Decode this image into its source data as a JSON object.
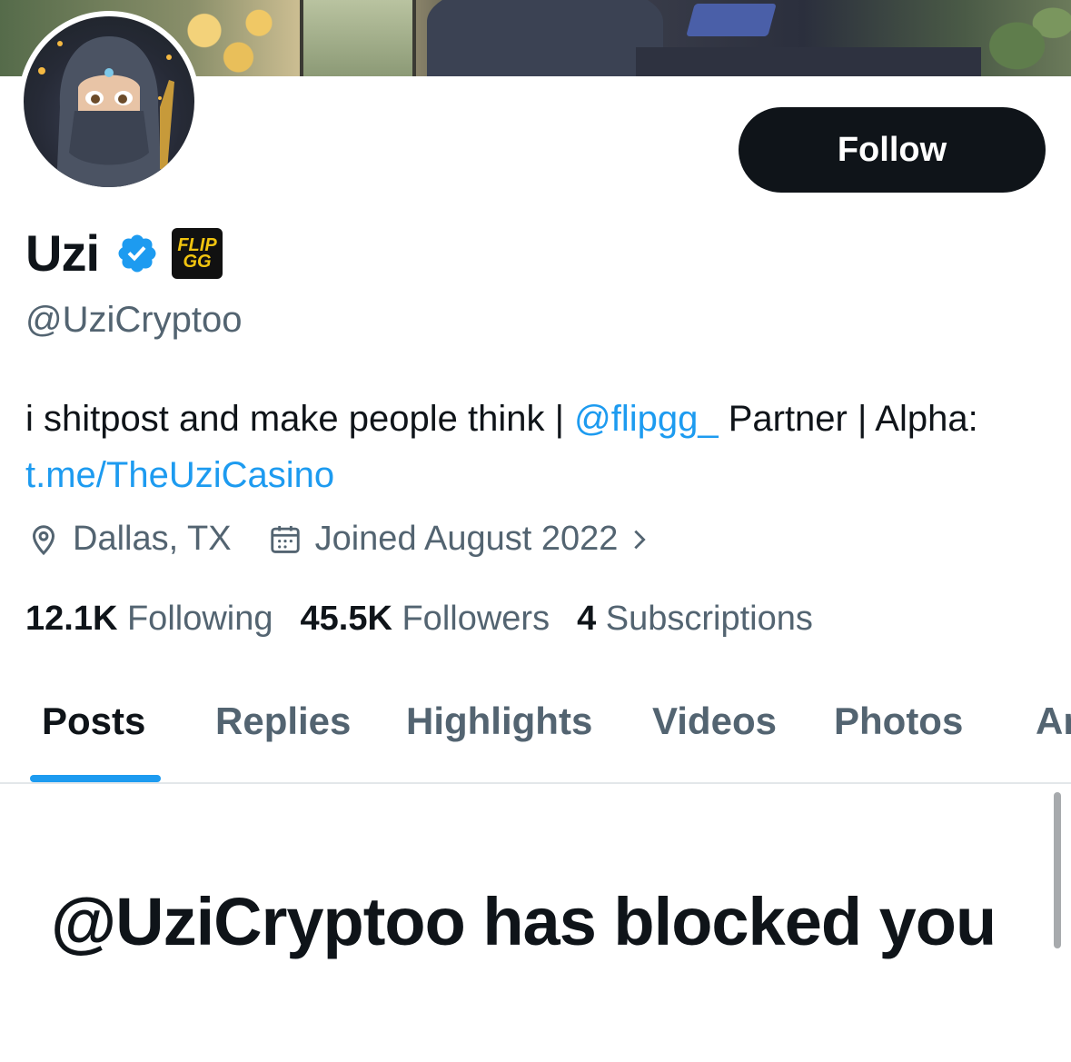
{
  "profile": {
    "display_name": "Uzi",
    "handle": "@UziCryptoo",
    "verified_icon": "verified-badge-icon",
    "affiliate_badge_text": "FLIP GG",
    "bio": {
      "text1": "i shitpost and make people think | ",
      "mention": "@flipgg_",
      "text2": " Partner | Alpha: ",
      "link": "t.me/TheUziCasino"
    },
    "location": "Dallas, TX",
    "joined": "Joined August 2022"
  },
  "actions": {
    "follow_label": "Follow"
  },
  "stats": {
    "following_count": "12.1K",
    "following_label": "Following",
    "followers_count": "45.5K",
    "followers_label": "Followers",
    "subscriptions_count": "4",
    "subscriptions_label": "Subscriptions"
  },
  "tabs": [
    {
      "label": "Posts",
      "active": true
    },
    {
      "label": "Replies",
      "active": false
    },
    {
      "label": "Highlights",
      "active": false
    },
    {
      "label": "Videos",
      "active": false
    },
    {
      "label": "Photos",
      "active": false
    },
    {
      "label": "Ar",
      "active": false
    }
  ],
  "blocked_message": "@UziCryptoo has blocked you",
  "colors": {
    "accent": "#1d9bf0",
    "text_primary": "#0f1419",
    "text_secondary": "#536471",
    "button_bg": "#0f1419"
  }
}
